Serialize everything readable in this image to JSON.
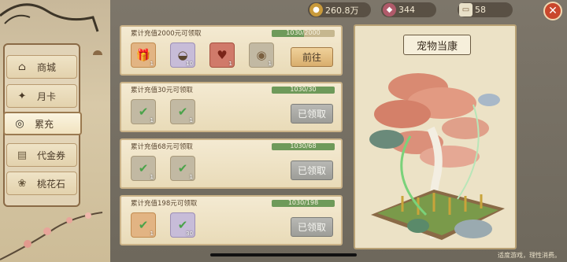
{
  "resources": [
    {
      "icon": "coin-icon",
      "value": "260.8万",
      "color": "#c99a3a"
    },
    {
      "icon": "gem-icon",
      "value": "344",
      "color": "#b05a6a"
    },
    {
      "icon": "ticket-icon",
      "value": "58",
      "color": "#e8e0c8"
    }
  ],
  "sidebar": {
    "items": [
      {
        "label": "商城",
        "icon": "shop-icon"
      },
      {
        "label": "月卡",
        "icon": "monthly-card-icon"
      },
      {
        "label": "累充",
        "icon": "recharge-icon",
        "active": true
      },
      {
        "label": "代金券",
        "icon": "voucher-icon"
      },
      {
        "label": "桃花石",
        "icon": "peach-stone-icon"
      }
    ]
  },
  "rewards": [
    {
      "title": "累计充值2000元可领取",
      "progress": "1030/2000",
      "progress_fraction": 0.515,
      "button": "前往",
      "claimed": false,
      "items": [
        {
          "icon": "chest-icon",
          "count": "1",
          "tone": "orange"
        },
        {
          "icon": "dumpling-icon",
          "count": "10",
          "tone": "purple"
        },
        {
          "icon": "fruit-icon",
          "count": "1",
          "tone": "red"
        },
        {
          "icon": "bag-icon",
          "count": "1",
          "tone": "grey"
        }
      ]
    },
    {
      "title": "累计充值30元可领取",
      "progress": "1030/30",
      "progress_fraction": 1,
      "button": "已领取",
      "claimed": true,
      "items": [
        {
          "icon": "check-icon",
          "count": "1",
          "tone": "grey"
        },
        {
          "icon": "check-icon",
          "count": "1",
          "tone": "grey"
        }
      ]
    },
    {
      "title": "累计充值68元可领取",
      "progress": "1030/68",
      "progress_fraction": 1,
      "button": "已领取",
      "claimed": true,
      "items": [
        {
          "icon": "check-icon",
          "count": "1",
          "tone": "grey"
        },
        {
          "icon": "check-icon",
          "count": "1",
          "tone": "grey"
        }
      ]
    },
    {
      "title": "累计充值198元可领取",
      "progress": "1030/198",
      "progress_fraction": 1,
      "button": "已领取",
      "claimed": true,
      "items": [
        {
          "icon": "check-icon",
          "count": "1",
          "tone": "grey"
        },
        {
          "icon": "check-icon",
          "count": "30",
          "tone": "grey"
        }
      ]
    }
  ],
  "preview": {
    "title": "宠物当康"
  },
  "footer": "适度游戏，理性消费。"
}
